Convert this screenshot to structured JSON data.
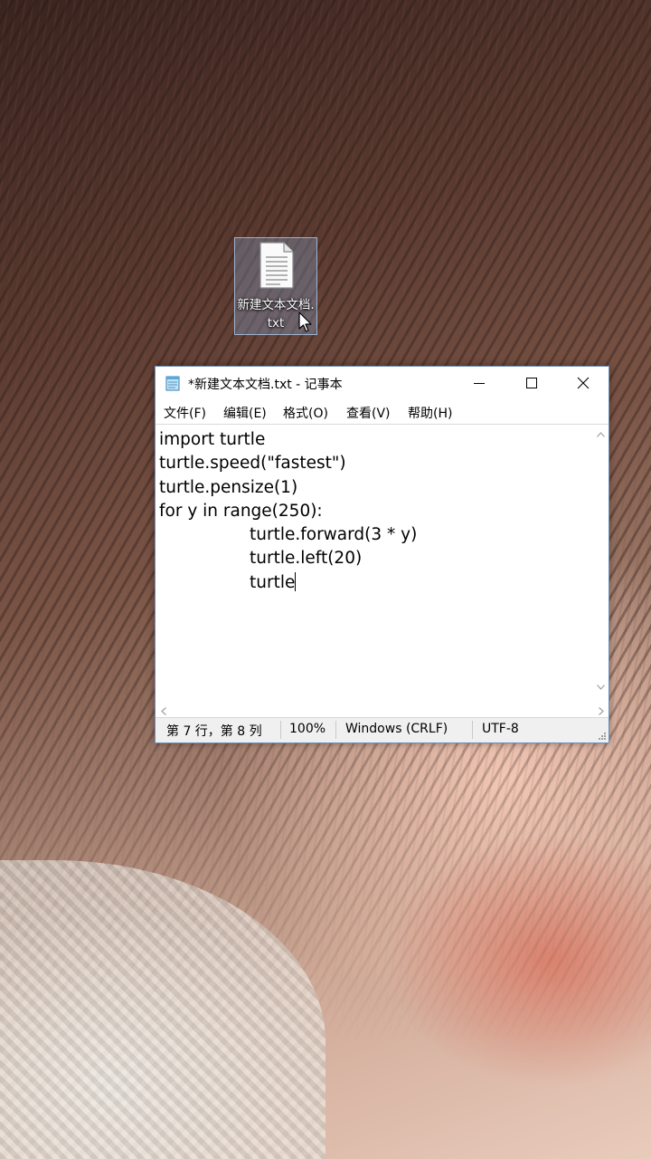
{
  "desktop": {
    "file_icon": {
      "label": "新建文本文档.txt",
      "icon": "text-file-icon"
    }
  },
  "window": {
    "title": "*新建文本文档.txt - 记事本",
    "app_icon": "notepad-icon",
    "controls": {
      "minimize_icon": "minimize-icon",
      "maximize_icon": "maximize-icon",
      "close_icon": "close-icon"
    },
    "menu": [
      {
        "label": "文件(F)"
      },
      {
        "label": "编辑(E)"
      },
      {
        "label": "格式(O)"
      },
      {
        "label": "查看(V)"
      },
      {
        "label": "帮助(H)"
      }
    ],
    "editor": {
      "lines": [
        "import turtle",
        "turtle.speed(\"fastest\")",
        "turtle.pensize(1)",
        "for y in range(250):",
        "turtle.forward(3 * y)",
        "turtle.left(20)",
        "turtle"
      ]
    },
    "status": {
      "position": "第 7 行，第 8 列",
      "zoom": "100%",
      "line_ending": "Windows (CRLF)",
      "encoding": "UTF-8"
    }
  }
}
